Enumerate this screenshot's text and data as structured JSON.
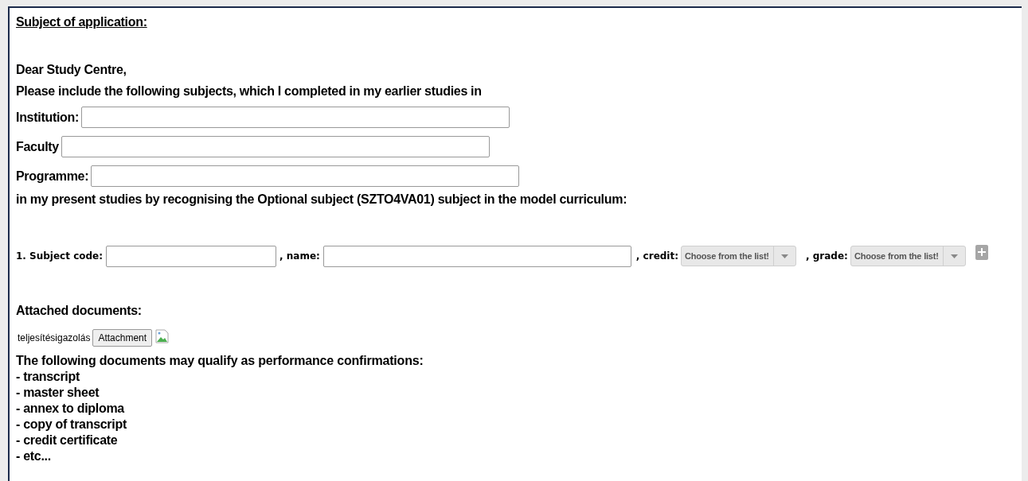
{
  "title": "Subject of application:",
  "greeting": "Dear Study Centre,",
  "intro": "Please include the following subjects, which I completed in my earlier studies in",
  "fields": [
    {
      "label": "Institution:"
    },
    {
      "label": "Faculty"
    },
    {
      "label": "Programme:"
    }
  ],
  "recognition_text": "in my present studies by recognising the Optional subject (SZTO4VA01) subject in the model curriculum:",
  "subject_row": {
    "code_label": "1. Subject code:",
    "name_label": ", name:",
    "credit_label": ", credit:",
    "credit_select": {
      "value": "Choose from the list!"
    },
    "grade_label": ", grade:",
    "grade_select": {
      "value": "Choose from the list!"
    }
  },
  "attachments": {
    "heading": "Attached documents:",
    "document_type": "teljesítésigazolás",
    "button": "Attachment"
  },
  "note": {
    "heading": "The following documents may qualify as performance confirmations:",
    "items": [
      "- transcript",
      "- master sheet",
      "- annex to diploma",
      "- copy of transcript",
      "- credit certificate",
      "- etc..."
    ]
  }
}
